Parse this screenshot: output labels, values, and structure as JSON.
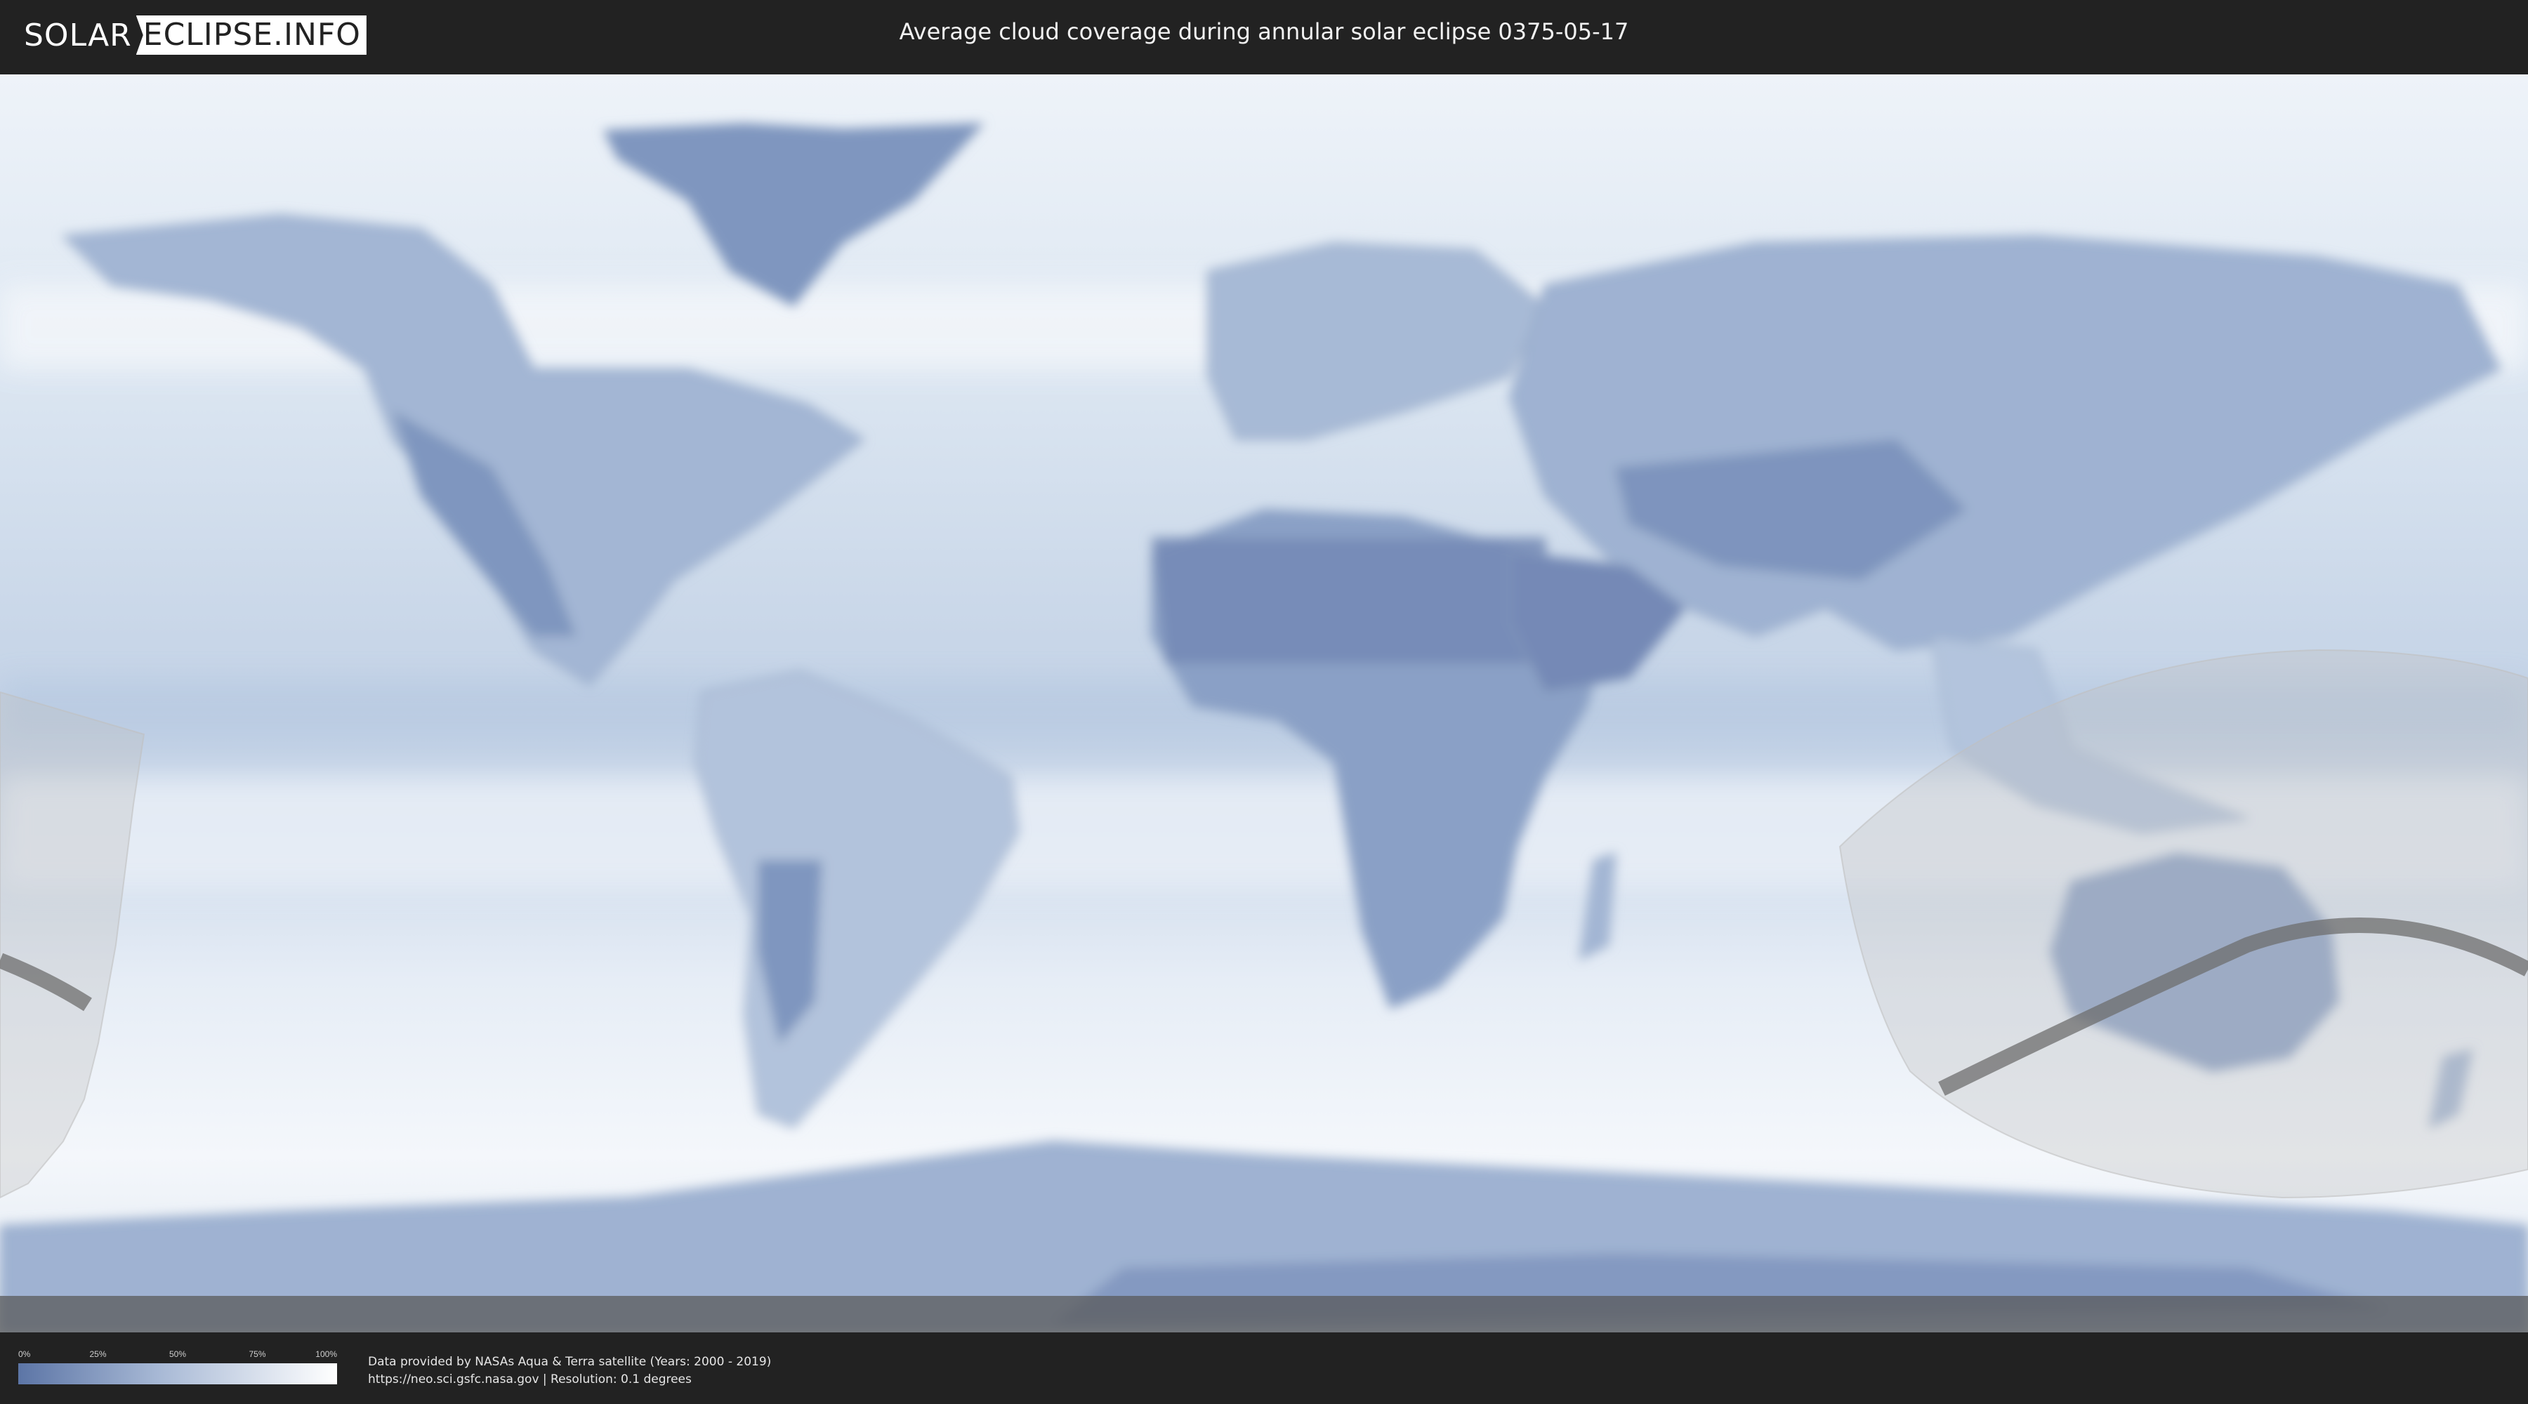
{
  "header": {
    "logo_left": "SOLAR",
    "logo_right": "ECLIPSE.INFO",
    "title": "Average cloud coverage during annular solar eclipse 0375-05-17"
  },
  "colors": {
    "background": "#222222",
    "cloud_clear": "#5c75a6",
    "cloud_full": "#ffffff",
    "eclipse_overlay": "#bfbfbf",
    "eclipse_path": "#6e6e6e"
  },
  "map": {
    "projection": "equirectangular",
    "layer": "average-cloud-coverage",
    "eclipse_type": "annular"
  },
  "legend": {
    "ticks": [
      "0%",
      "25%",
      "50%",
      "75%",
      "100%"
    ],
    "tick_values": [
      0,
      0.25,
      0.5,
      0.75,
      1
    ]
  },
  "footer": {
    "credit_line": "Data provided by NASAs Aqua & Terra satellite (Years: 2000 - 2019)",
    "source_line": "https://neo.sci.gsfc.nasa.gov | Resolution: 0.1 degrees"
  }
}
